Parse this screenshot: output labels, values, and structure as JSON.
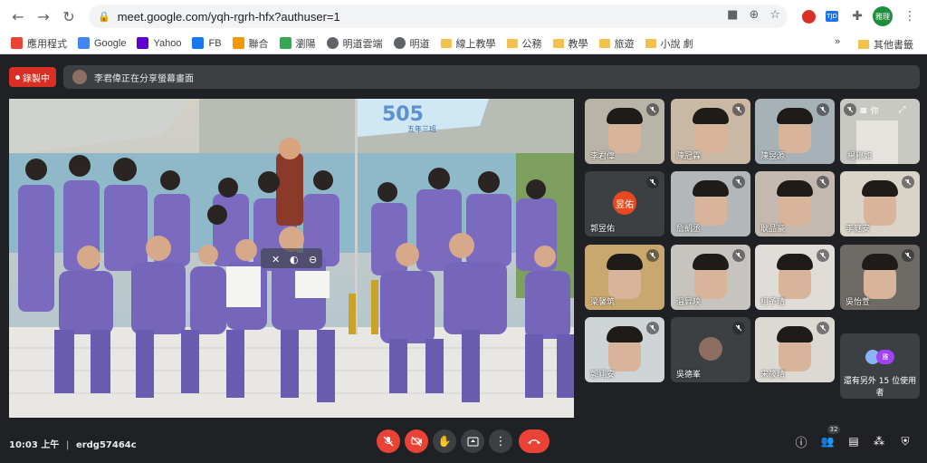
{
  "browser": {
    "url": "meet.google.com/yqh-rgrh-hfx?authuser=1",
    "profile_label": "雅理",
    "ext_tjd": "TJD"
  },
  "bookmarks": {
    "items": [
      {
        "label": "應用程式",
        "icon": "apps-grid-icon"
      },
      {
        "label": "Google",
        "icon": "google-icon"
      },
      {
        "label": "Yahoo",
        "icon": "yahoo-icon"
      },
      {
        "label": "FB",
        "icon": "facebook-icon"
      },
      {
        "label": "聯合",
        "icon": "udn-icon"
      },
      {
        "label": "瀏陽",
        "icon": "site-icon"
      },
      {
        "label": "明道雲端",
        "icon": "globe-icon"
      },
      {
        "label": "明道",
        "icon": "globe-icon"
      },
      {
        "label": "線上教學",
        "icon": "folder-icon"
      },
      {
        "label": "公務",
        "icon": "folder-icon"
      },
      {
        "label": "教學",
        "icon": "folder-icon"
      },
      {
        "label": "旅遊",
        "icon": "folder-icon"
      },
      {
        "label": "小說 劇",
        "icon": "folder-icon"
      }
    ],
    "more": "»",
    "other": "其他書籤"
  },
  "meet": {
    "recording_label": "錄製中",
    "presenting_text": "李君偉正在分享螢幕畫面",
    "time": "10:03 上午",
    "separator": "|",
    "meeting_code": "erdg57464c",
    "participant_count": "32",
    "banner_text": "505",
    "banner_sub": "五年三班",
    "self_label": "你",
    "more_users": "還有另外 15 位使用者"
  },
  "participants": [
    {
      "name": "李君偉",
      "type": "video",
      "bg": "#b9b4a8"
    },
    {
      "name": "陳冠霖",
      "type": "video",
      "bg": "#c8b8a4"
    },
    {
      "name": "陳昱源",
      "type": "video",
      "bg": "#a7b2b8"
    },
    {
      "name": "楊穆如",
      "type": "video",
      "bg": "#cfcfca"
    },
    {
      "name": "郭昱佑",
      "type": "avatar",
      "initial": "昱佑",
      "bg": "#3c4043",
      "avatar_color": "#e8491d"
    },
    {
      "name": "詹凱丞",
      "type": "video",
      "bg": "#b3b7b9"
    },
    {
      "name": "耿品豪",
      "type": "video",
      "bg": "#c4b9b0"
    },
    {
      "name": "李庭安",
      "type": "video",
      "bg": "#d9d3c8"
    },
    {
      "name": "梁馨筑",
      "type": "video",
      "bg": "#c9a86f"
    },
    {
      "name": "溫昇映",
      "type": "video",
      "bg": "#c7c4c0"
    },
    {
      "name": "柯予晴",
      "type": "video",
      "bg": "#e0dcd8"
    },
    {
      "name": "吳怡萱",
      "type": "video",
      "bg": "#6e6a66"
    },
    {
      "name": "郭翊安",
      "type": "video",
      "bg": "#cfd4d6"
    },
    {
      "name": "吳德峯",
      "type": "avatar",
      "initial": "",
      "bg": "#3c4043",
      "avatar_color": "#8d6e63"
    },
    {
      "name": "宋筱晴",
      "type": "video",
      "bg": "#dcd8d2"
    }
  ]
}
